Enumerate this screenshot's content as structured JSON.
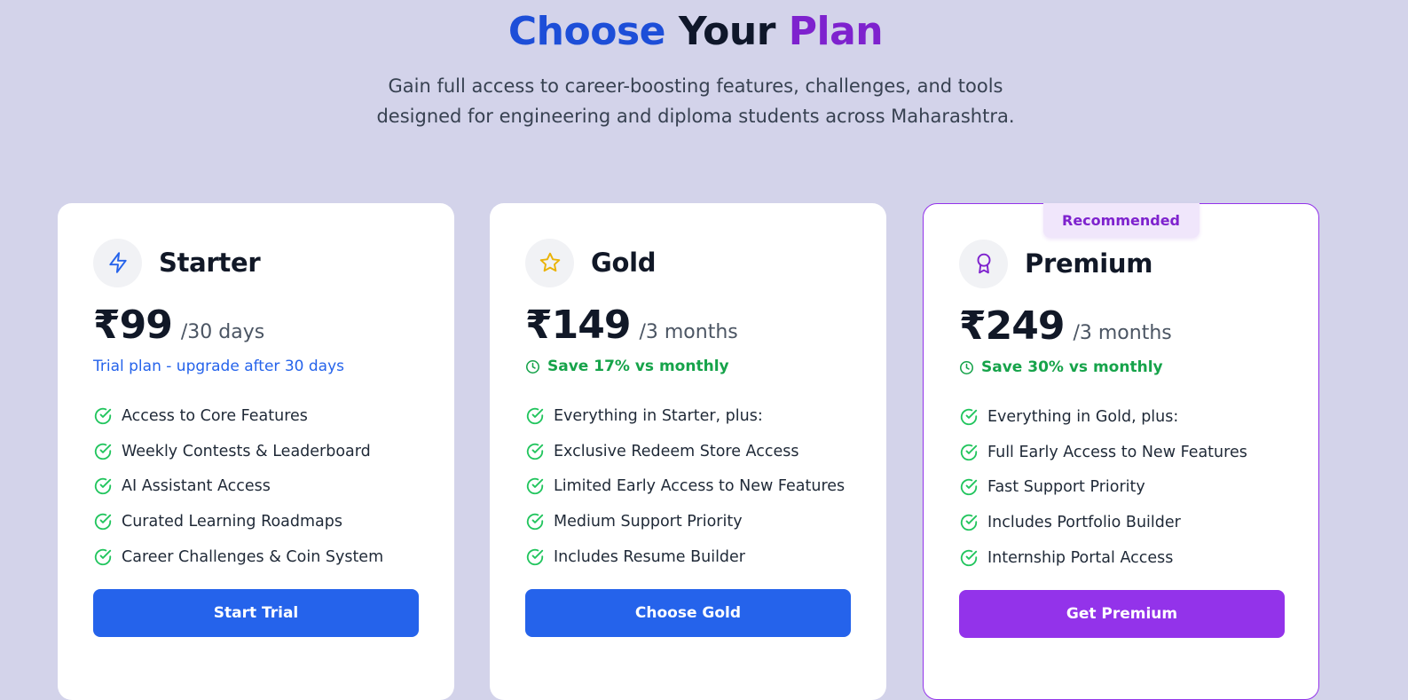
{
  "header": {
    "title_word_1": "Choose",
    "title_word_2": "Your",
    "title_word_3": "Plan",
    "subtitle_line_1": "Gain full access to career-boosting features, challenges, and tools",
    "subtitle_line_2": "designed for engineering and diploma students across Maharashtra."
  },
  "colors": {
    "background": "#d3d3ea",
    "blue_accent": "#2563eb",
    "purple_accent": "#9333ea",
    "green_check": "#22c55e",
    "gold_star": "#eab308"
  },
  "plans": [
    {
      "icon": "lightning-icon",
      "name": "Starter",
      "price": "₹99",
      "period": "/30 days",
      "note": "Trial plan - upgrade after 30 days",
      "features": [
        "Access to Core Features",
        "Weekly Contests & Leaderboard",
        "AI Assistant Access",
        "Curated Learning Roadmaps",
        "Career Challenges & Coin System"
      ],
      "button": "Start Trial"
    },
    {
      "icon": "star-icon",
      "name": "Gold",
      "price": "₹149",
      "period": "/3 months",
      "note": "Save 17% vs monthly",
      "features": [
        "Everything in Starter, plus:",
        "Exclusive Redeem Store Access",
        "Limited Early Access to New Features",
        "Medium Support Priority",
        "Includes Resume Builder"
      ],
      "button": "Choose Gold"
    },
    {
      "icon": "award-icon",
      "name": "Premium",
      "badge": "Recommended",
      "price": "₹249",
      "period": "/3 months",
      "note": "Save 30% vs monthly",
      "features": [
        "Everything in Gold, plus:",
        "Full Early Access to New Features",
        "Fast Support Priority",
        "Includes Portfolio Builder",
        "Internship Portal Access"
      ],
      "button": "Get Premium"
    }
  ]
}
